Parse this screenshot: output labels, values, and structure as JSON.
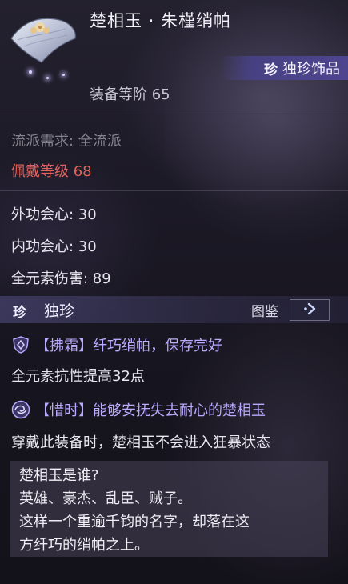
{
  "item": {
    "title": "楚相玉 · 朱槿绡帕",
    "icon": "silk-handkerchief-icon",
    "rarity_badge": "珍",
    "rarity_label": "独珍饰品",
    "equip_level": "装备等阶 65"
  },
  "requirements": {
    "school": "流派需求: 全流派",
    "wear_level_label": "佩戴等级",
    "wear_level_value": "68"
  },
  "stats": [
    "外功会心: 30",
    "内功会心: 30",
    "全元素伤害: 89"
  ],
  "unique": {
    "badge": "珍",
    "name": "独珍",
    "tujian_label": "图鉴",
    "tujian_icon": "arrow-right-icon",
    "skills": [
      {
        "icon": "shield-icon",
        "title": "【拂霜】纤巧绡帕，保存完好",
        "desc": "全元素抗性提高32点"
      },
      {
        "icon": "swirl-icon",
        "title": "【惜时】能够安抚失去耐心的楚相玉",
        "desc": "穿戴此装备时，楚相玉不会进入狂暴状态"
      }
    ]
  },
  "lore": [
    "楚相玉是谁?",
    "英雄、豪杰、乱臣、贼子。",
    "这样一个重逾千钧的名字，却落在这",
    "方纤巧的绡帕之上。"
  ],
  "colors": {
    "background": "#1c1926",
    "warning": "#e0625c",
    "skill_title": "#b9a9ff",
    "rarity_tag": "#4f4896"
  }
}
